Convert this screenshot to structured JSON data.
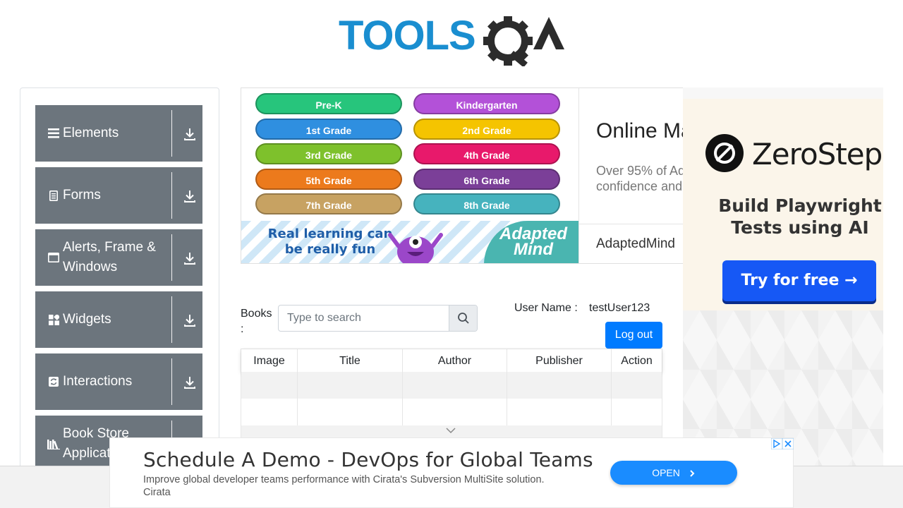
{
  "header": {
    "logo_text": "TOOLSQA"
  },
  "sidebar": {
    "groups": [
      {
        "label": "Elements",
        "icon": "hamburger-icon"
      },
      {
        "label": "Forms",
        "icon": "document-icon"
      },
      {
        "label": "Alerts, Frame & Windows",
        "icon": "window-icon"
      },
      {
        "label": "Widgets",
        "icon": "widgets-icon"
      },
      {
        "label": "Interactions",
        "icon": "interactions-icon"
      },
      {
        "label": "Book Store Application",
        "icon": "library-icon"
      }
    ]
  },
  "ad_main": {
    "grades": [
      {
        "label": "Pre-K",
        "color": "#27c57c"
      },
      {
        "label": "Kindergarten",
        "color": "#b351d8"
      },
      {
        "label": "1st Grade",
        "color": "#2f8fe0"
      },
      {
        "label": "2nd Grade",
        "color": "#f5c400"
      },
      {
        "label": "3rd Grade",
        "color": "#7ec12c"
      },
      {
        "label": "4th Grade",
        "color": "#e8196b"
      },
      {
        "label": "5th Grade",
        "color": "#ec7a1c"
      },
      {
        "label": "6th Grade",
        "color": "#7b3f98"
      },
      {
        "label": "7th Grade",
        "color": "#c7a262"
      },
      {
        "label": "8th Grade",
        "color": "#46b3be"
      }
    ],
    "tagline": "Real learning can be really fun",
    "adapted_logo": "Adapted Mind",
    "title": "Online Ma",
    "desc_line1": "Over 95% of Ad",
    "desc_line2": "confidence and",
    "brand": "AdaptedMind"
  },
  "ad_right": {
    "brand": "ZeroStep",
    "tagline": "Build Playwright Tests using AI",
    "cta": "Try for free →",
    "accent": "#1658f5"
  },
  "bookstore": {
    "books_label": "Books :",
    "search_placeholder": "Type to search",
    "user_label": "User Name :",
    "user_value": "testUser123",
    "logout": "Log out",
    "columns": [
      "Image",
      "Title",
      "Author",
      "Publisher",
      "Action"
    ]
  },
  "ad_bottom": {
    "title": "Schedule A Demo - DevOps for Global Teams",
    "desc": "Improve global developer teams performance with Cirata's Subversion MultiSite solution.",
    "brand": "Cirata",
    "cta": "OPEN"
  }
}
